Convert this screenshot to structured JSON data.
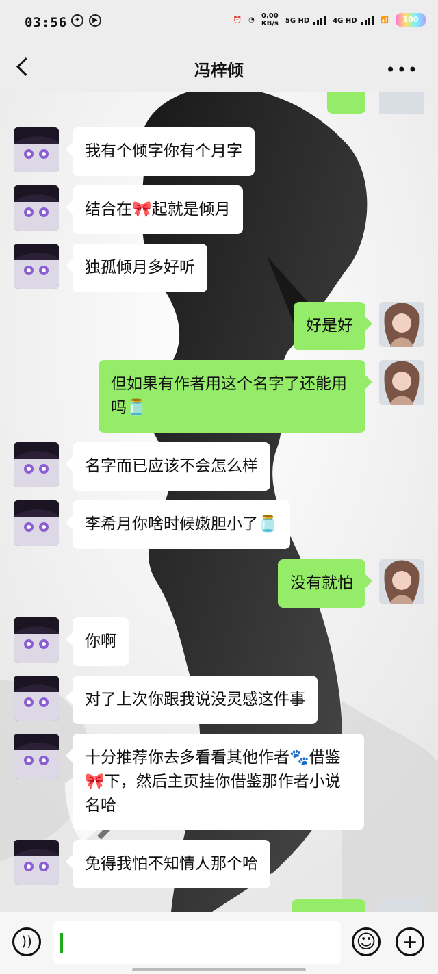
{
  "status_bar": {
    "time": "03:56",
    "net_speed": "0.00\nKB/s",
    "sim1": "5G HD",
    "sim2": "4G HD",
    "battery": "100"
  },
  "header": {
    "title": "冯梓倾",
    "more": "•••"
  },
  "messages": [
    {
      "side": "in",
      "text": "我有个倾字你有个月字"
    },
    {
      "side": "in",
      "text": "结合在🎀起就是倾月"
    },
    {
      "side": "in",
      "text": "独孤倾月多好听"
    },
    {
      "side": "out",
      "text": "好是好"
    },
    {
      "side": "out",
      "text": "但如果有作者用这个名字了还能用吗🫙"
    },
    {
      "side": "in",
      "text": "名字而已应该不会怎么样"
    },
    {
      "side": "in",
      "text": "李希月你啥时候嫩胆小了🫙"
    },
    {
      "side": "out",
      "text": "没有就怕"
    },
    {
      "side": "in",
      "text": "你啊"
    },
    {
      "side": "in",
      "text": "对了上次你跟我说没灵感这件事"
    },
    {
      "side": "in",
      "text": "十分推荐你去多看看其他作者🐾借鉴🎀下，然后主页挂你借鉴那作者小说名哈"
    },
    {
      "side": "in",
      "text": "免得我怕不知情人那个哈"
    }
  ],
  "composer": {
    "voice_icon": "voice-icon",
    "emoji_icon": "emoji-icon",
    "plus_icon": "plus-icon"
  }
}
